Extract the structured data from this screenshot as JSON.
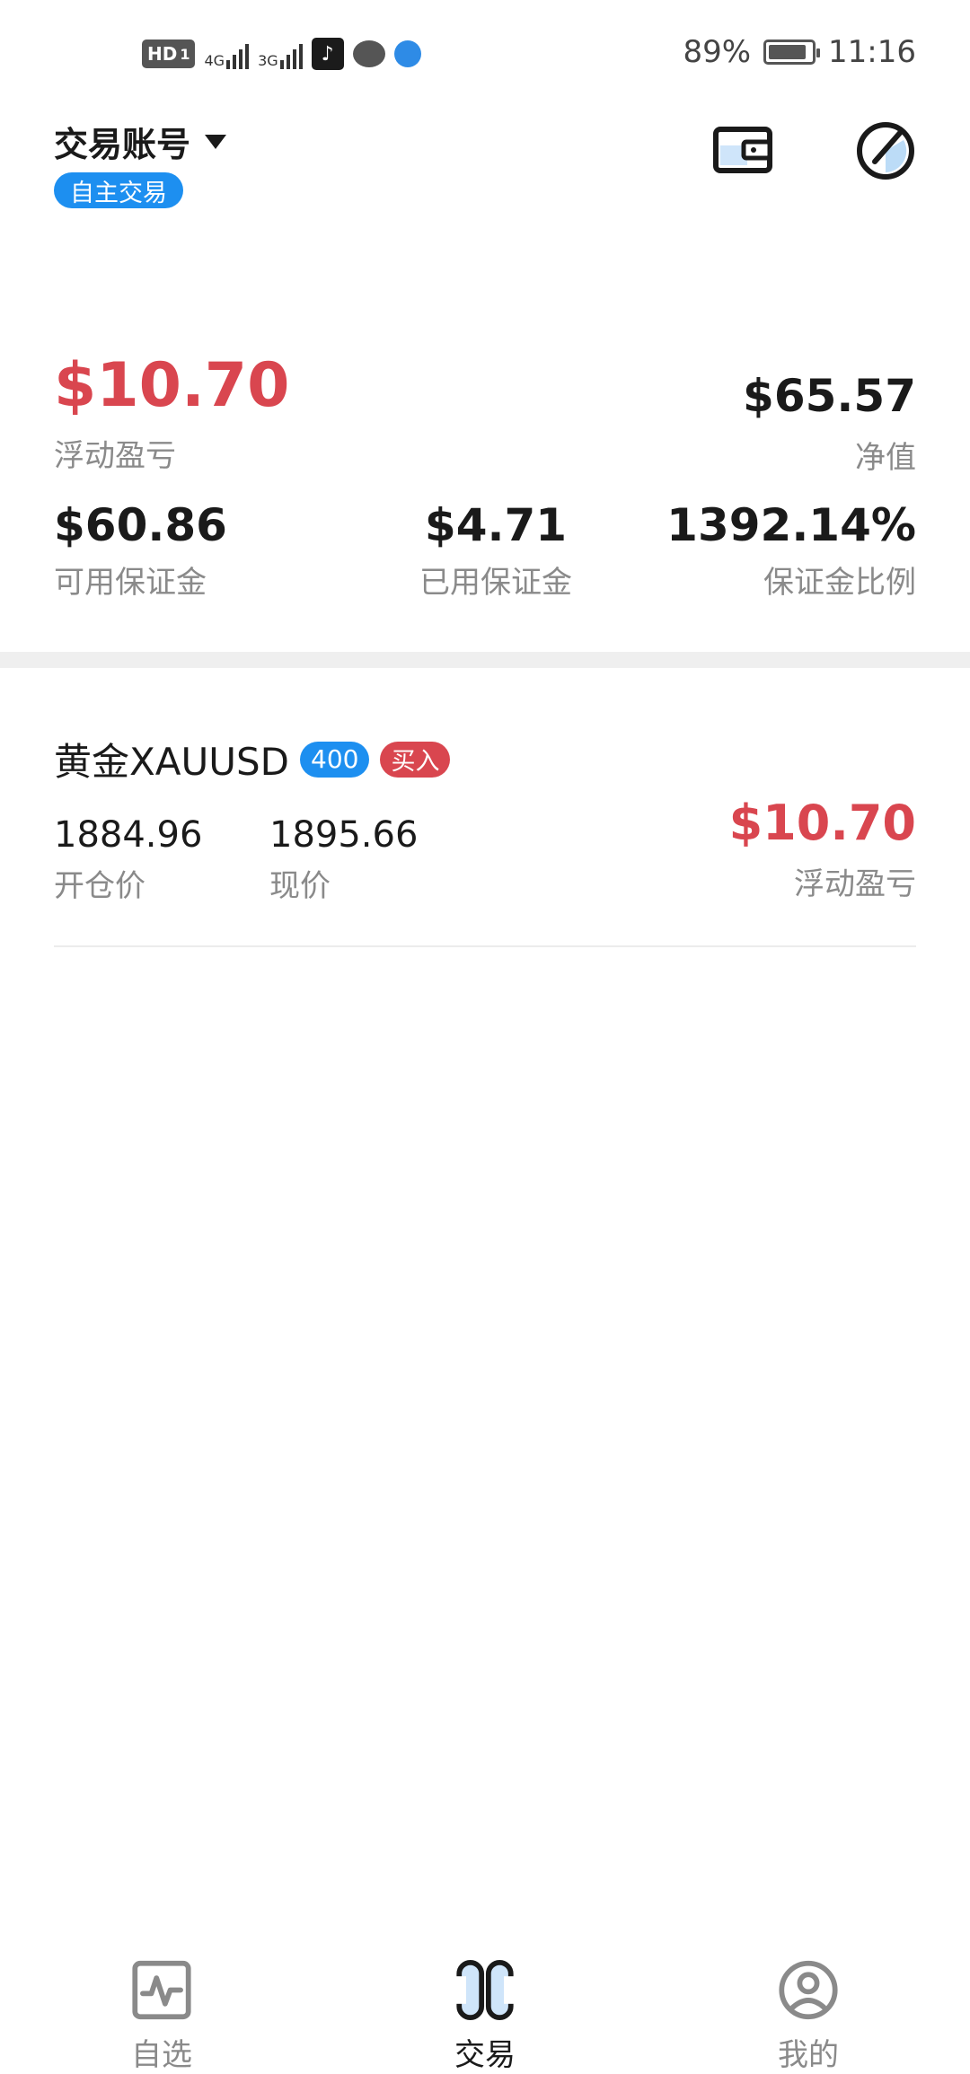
{
  "status_bar": {
    "hd_badge": "HD",
    "hd_sub": "1",
    "network1": "4G",
    "network2": "3G",
    "battery": "89%",
    "battery_level": 0.89,
    "time": "11:16"
  },
  "header": {
    "account_label": "交易账号",
    "mode_badge": "自主交易",
    "icons": [
      "wallet-icon",
      "history-icon"
    ]
  },
  "summary": {
    "floating_pnl": "$10.70",
    "floating_pnl_label": "浮动盈亏",
    "equity": "$65.57",
    "equity_label": "净值",
    "free_margin": "$60.86",
    "free_margin_label": "可用保证金",
    "used_margin": "$4.71",
    "used_margin_label": "已用保证金",
    "margin_level": "1392.14%",
    "margin_level_label": "保证金比例"
  },
  "positions": [
    {
      "symbol": "黄金XAUUSD",
      "lots_badge": "400",
      "side_badge": "买入",
      "open_price": "1884.96",
      "open_price_label": "开仓价",
      "current_price": "1895.66",
      "current_price_label": "现价",
      "pnl": "$10.70",
      "pnl_label": "浮动盈亏"
    }
  ],
  "bottom_nav": {
    "items": [
      {
        "label": "自选",
        "icon": "watchlist-icon",
        "active": false
      },
      {
        "label": "交易",
        "icon": "trade-icon",
        "active": true
      },
      {
        "label": "我的",
        "icon": "profile-icon",
        "active": false
      }
    ]
  },
  "colors": {
    "accent_blue": "#1d8ff0",
    "loss_profit_red": "#d9464f",
    "secondary_text": "#8a8a8a"
  }
}
